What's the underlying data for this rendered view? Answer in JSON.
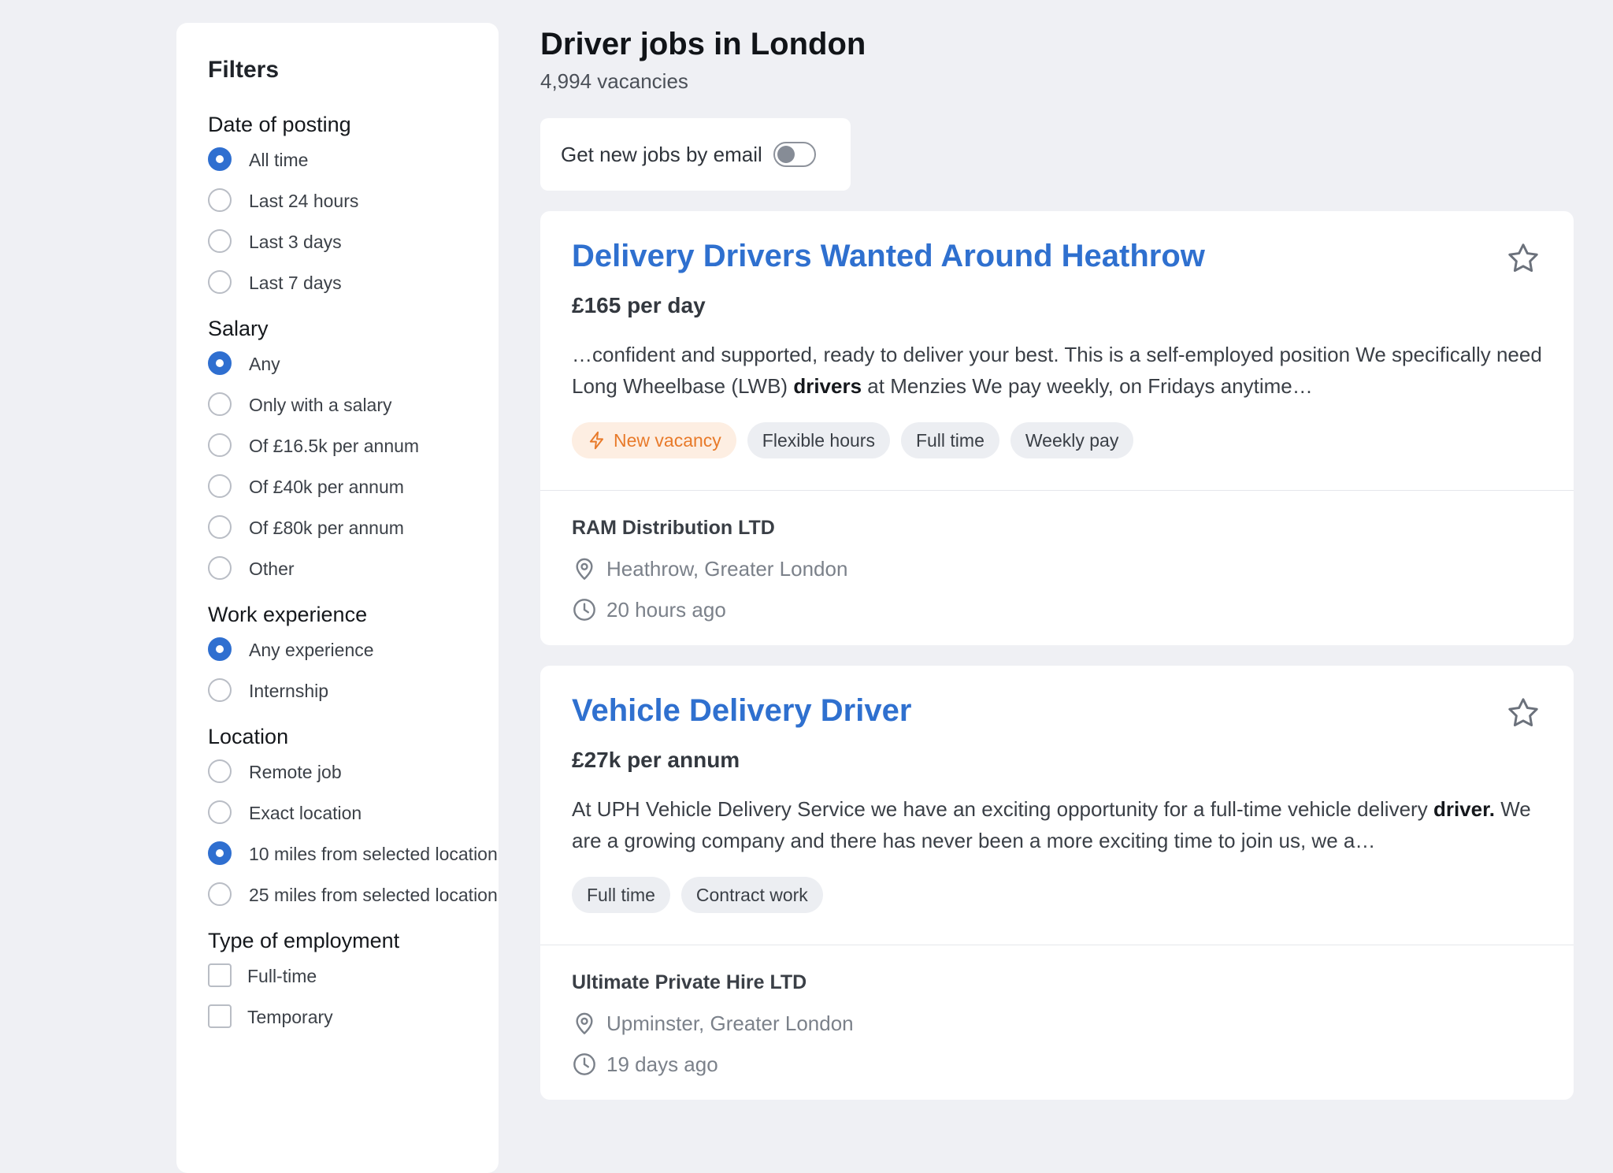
{
  "filters": {
    "title": "Filters",
    "groups": [
      {
        "title": "Date of posting",
        "type": "radio",
        "options": [
          {
            "label": "All time",
            "selected": true
          },
          {
            "label": "Last 24 hours",
            "selected": false
          },
          {
            "label": "Last 3 days",
            "selected": false
          },
          {
            "label": "Last 7 days",
            "selected": false
          }
        ]
      },
      {
        "title": "Salary",
        "type": "radio",
        "options": [
          {
            "label": "Any",
            "selected": true
          },
          {
            "label": "Only with a salary",
            "selected": false
          },
          {
            "label": "Of £16.5k per annum",
            "selected": false
          },
          {
            "label": "Of £40k per annum",
            "selected": false
          },
          {
            "label": "Of £80k per annum",
            "selected": false
          },
          {
            "label": "Other",
            "selected": false
          }
        ]
      },
      {
        "title": "Work experience",
        "type": "radio",
        "options": [
          {
            "label": "Any experience",
            "selected": true
          },
          {
            "label": "Internship",
            "selected": false
          }
        ]
      },
      {
        "title": "Location",
        "type": "radio",
        "options": [
          {
            "label": "Remote job",
            "selected": false
          },
          {
            "label": "Exact location",
            "selected": false
          },
          {
            "label": "10 miles from selected location",
            "selected": true
          },
          {
            "label": "25 miles from selected location",
            "selected": false
          }
        ]
      },
      {
        "title": "Type of employment",
        "type": "checkbox",
        "options": [
          {
            "label": "Full-time",
            "selected": false
          },
          {
            "label": "Temporary",
            "selected": false
          }
        ]
      }
    ]
  },
  "header": {
    "title": "Driver jobs in London",
    "count": "4,994 vacancies"
  },
  "email_alert": {
    "label": "Get new jobs by email",
    "enabled": false
  },
  "jobs": [
    {
      "title": "Delivery Drivers Wanted Around Heathrow",
      "salary": "£165 per day",
      "description_parts": [
        {
          "text": "…confident and supported, ready to deliver your best. This is a self-employed position We specifically need Long Wheelbase (LWB) ",
          "bold": false
        },
        {
          "text": "drivers",
          "bold": true
        },
        {
          "text": " at Menzies We pay weekly, on Fridays anytime…",
          "bold": false
        }
      ],
      "tags": [
        {
          "label": "New vacancy",
          "highlight": true,
          "icon": "lightning-icon"
        },
        {
          "label": "Flexible hours",
          "highlight": false
        },
        {
          "label": "Full time",
          "highlight": false
        },
        {
          "label": "Weekly pay",
          "highlight": false
        }
      ],
      "company": "RAM Distribution LTD",
      "location": "Heathrow, Greater London",
      "posted": "20 hours ago"
    },
    {
      "title": "Vehicle Delivery Driver",
      "salary": "£27k per annum",
      "description_parts": [
        {
          "text": "At UPH Vehicle Delivery Service we have an exciting opportunity for a full-time vehicle delivery ",
          "bold": false
        },
        {
          "text": "driver.",
          "bold": true
        },
        {
          "text": " We are a growing company and there has never been a more exciting time to join us, we a…",
          "bold": false
        }
      ],
      "tags": [
        {
          "label": "Full time",
          "highlight": false
        },
        {
          "label": "Contract work",
          "highlight": false
        }
      ],
      "company": "Ultimate Private Hire LTD",
      "location": "Upminster, Greater London",
      "posted": "19 days ago"
    }
  ],
  "icons": {
    "save": "star-icon",
    "location": "map-pin-icon",
    "time": "clock-icon",
    "new": "lightning-icon"
  },
  "colors": {
    "accent": "#2f6fd0",
    "link": "#2f70cf",
    "new_tag_text": "#e87a2a",
    "new_tag_bg": "#fdeee2",
    "background": "#eff0f4"
  }
}
